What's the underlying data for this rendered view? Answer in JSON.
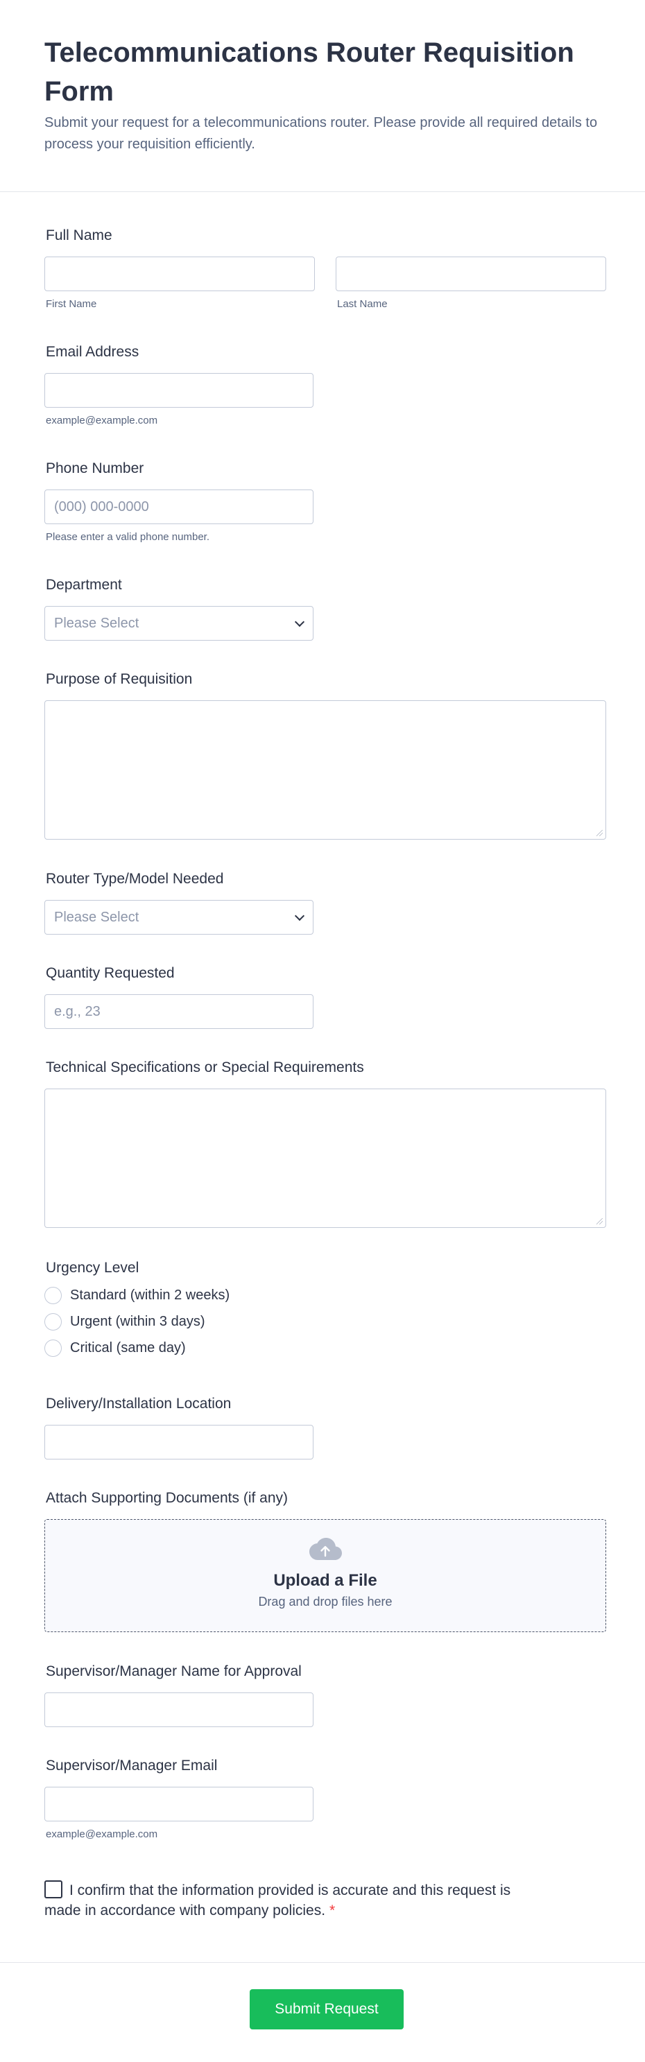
{
  "header": {
    "title": "Telecommunications Router Requisition Form",
    "subtitle": "Submit your request for a telecommunications router. Please provide all required details to process your requisition efficiently."
  },
  "full_name": {
    "label": "Full Name",
    "first_value": "",
    "last_value": "",
    "first_sublabel": "First Name",
    "last_sublabel": "Last Name"
  },
  "email": {
    "label": "Email Address",
    "value": "",
    "sublabel": "example@example.com"
  },
  "phone": {
    "label": "Phone Number",
    "placeholder": "(000) 000-0000",
    "sublabel": "Please enter a valid phone number."
  },
  "department": {
    "label": "Department",
    "selected": "Please Select"
  },
  "purpose": {
    "label": "Purpose of Requisition",
    "value": ""
  },
  "router_type": {
    "label": "Router Type/Model Needed",
    "selected": "Please Select"
  },
  "quantity": {
    "label": "Quantity Requested",
    "placeholder": "e.g., 23"
  },
  "specs": {
    "label": "Technical Specifications or Special Requirements",
    "value": ""
  },
  "urgency": {
    "label": "Urgency Level",
    "options": [
      "Standard (within 2 weeks)",
      "Urgent (within 3 days)",
      "Critical (same day)"
    ]
  },
  "location": {
    "label": "Delivery/Installation Location",
    "value": ""
  },
  "attachments": {
    "label": "Attach Supporting Documents (if any)",
    "title": "Upload a File",
    "subtitle": "Drag and drop files here",
    "icon": "cloud-upload-icon"
  },
  "supervisor_name": {
    "label": "Supervisor/Manager Name for Approval",
    "value": ""
  },
  "supervisor_email": {
    "label": "Supervisor/Manager Email",
    "value": "",
    "sublabel": "example@example.com"
  },
  "confirmation": {
    "text": "I confirm that the information provided is accurate and this request is made in accordance with company policies.",
    "required_mark": "*"
  },
  "submit": {
    "label": "Submit Request"
  },
  "colors": {
    "accent": "#18bd5b",
    "required": "#f23a3c",
    "text": "#2c3345",
    "muted": "#57647e",
    "border": "#c3cad8"
  }
}
